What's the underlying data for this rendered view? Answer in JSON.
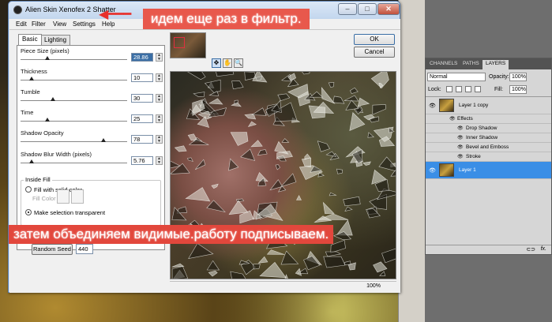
{
  "dialog": {
    "title": "Alien Skin Xenofex 2 Shatter",
    "menu": [
      "Edit",
      "Filter",
      "View",
      "Settings",
      "Help"
    ],
    "tabs": [
      "Basic",
      "Lighting"
    ],
    "params": [
      {
        "label": "Piece Size (pixels)",
        "value": "28.86",
        "level": 0.25
      },
      {
        "label": "Thickness",
        "value": "10",
        "level": 0.1
      },
      {
        "label": "Tumble",
        "value": "30",
        "level": 0.3
      },
      {
        "label": "Time",
        "value": "25",
        "level": 0.25
      },
      {
        "label": "Shadow Opacity",
        "value": "78",
        "level": 0.78
      },
      {
        "label": "Shadow Blur Width (pixels)",
        "value": "5.76",
        "level": 0.1
      }
    ],
    "inside_fill": {
      "title": "Inside Fill",
      "option_solid": "Fill with solid color",
      "fill_color_label": "Fill Color",
      "option_transparent": "Make selection transparent"
    },
    "random_seed_label": "Random Seed",
    "random_seed_value": "440",
    "ok_label": "OK",
    "cancel_label": "Cancel",
    "zoom_level": "100%"
  },
  "annotations": {
    "top": "идем еще раз в фильтр.",
    "bottom": "затем объединяем видимые.работу подписываем."
  },
  "layers_panel": {
    "tabs": [
      "CHANNELS",
      "PATHS",
      "LAYERS"
    ],
    "blend_mode": "Normal",
    "opacity_label": "Opacity:",
    "opacity_value": "100%",
    "lock_label": "Lock:",
    "fill_label": "Fill:",
    "fill_value": "100%",
    "layers": [
      {
        "name": "Layer 1 copy"
      },
      {
        "name": "Effects"
      },
      {
        "name": "Drop Shadow"
      },
      {
        "name": "Inner Shadow"
      },
      {
        "name": "Bevel and Emboss"
      },
      {
        "name": "Stroke"
      },
      {
        "name": "Layer 1"
      }
    ]
  }
}
